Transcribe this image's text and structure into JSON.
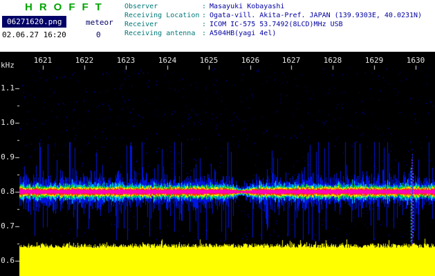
{
  "app": {
    "title": "HROFFT",
    "title_color": "#00a400"
  },
  "header": {
    "filename": "06271620.png",
    "mode": "meteor",
    "datetime": "02.06.27 16:20",
    "count": "0",
    "info": [
      {
        "label": "Observer",
        "value": "Masayuki Kobayashi"
      },
      {
        "label": "Receiving Location",
        "value": "Ogata-vill. Akita-Pref. JAPAN (139.9303E, 40.0231N)"
      },
      {
        "label": "Receiver",
        "value": "ICOM IC-575 53.7492(8LCD)MHz USB"
      },
      {
        "label": "Receiving antenna",
        "value": "A504HB(yagi 4el)"
      }
    ]
  },
  "chart_data": {
    "type": "heatmap",
    "title": "",
    "x_axis": {
      "label": "",
      "ticks": [
        "1621",
        "1622",
        "1623",
        "1624",
        "1625",
        "1626",
        "1627",
        "1628",
        "1629",
        "1630"
      ]
    },
    "y_axis": {
      "label": "kHz",
      "ticks": [
        "1.1",
        "1.0",
        "0.9",
        "0.8",
        "0.7",
        "0.6"
      ],
      "range_khz": [
        0.6,
        1.1
      ]
    },
    "signal": {
      "carrier_center_khz": 0.8,
      "quiet_dip_at_minute": "1626",
      "meteor_echo_at_minute": "1629.9",
      "meteor_echo_khz_span": [
        0.65,
        1.0
      ],
      "level_strip": "solid yellow signal-level band along bottom with jagged black trace"
    },
    "colors": {
      "background": "#000000",
      "noise_blue": "#0016dd",
      "speckle_blue": "#000088",
      "cyan": "#00c8ff",
      "green": "#00cc33",
      "yellow": "#ffee00",
      "red": "#ff3300",
      "magenta": "#ff00bb",
      "level_strip": "#ffff00",
      "axis_text": "#e8e8e8"
    }
  }
}
